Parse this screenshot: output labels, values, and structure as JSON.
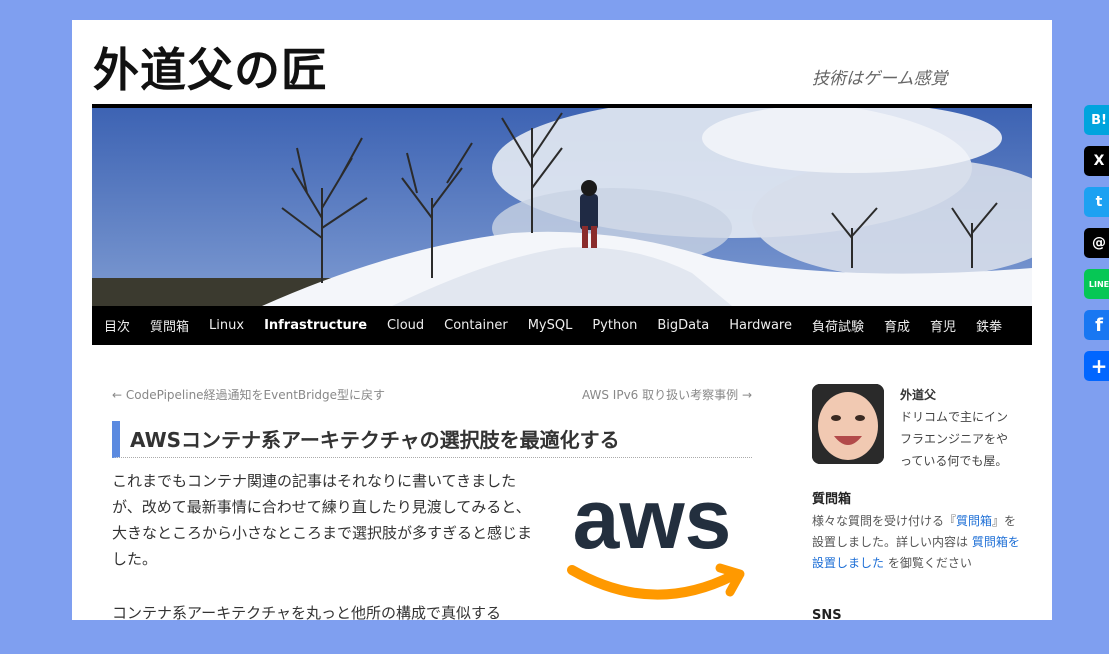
{
  "site": {
    "title": "外道父の匠",
    "description": "技術はゲーム感覚"
  },
  "nav": {
    "items": [
      "目次",
      "質問箱",
      "Linux",
      "Infrastructure",
      "Cloud",
      "Container",
      "MySQL",
      "Python",
      "BigData",
      "Hardware",
      "負荷試験",
      "育成",
      "育児",
      "鉄拳"
    ],
    "active": "Infrastructure"
  },
  "post": {
    "prev_link": "← CodePipeline経過通知をEventBridge型に戻す",
    "next_link": "AWS IPv6 取り扱い考察事例 →",
    "title": "AWSコンテナ系アーキテクチャの選択肢を最適化する",
    "para1": "これまでもコンテナ関連の記事はそれなりに書いてきましたが、改めて最新事情に合わせて練り直したり見渡してみると、大きなところから小さなところまで選択肢が多すぎると感じました。",
    "para2": "コンテナ系アーキテクチャを丸っと他所の構成で真似する",
    "logo_text": "aws"
  },
  "sidebar": {
    "profile_name": "外道父",
    "profile_text": "ドリコムで主にインフラエンジニアをやっている何でも屋。",
    "widget_title": "質問箱",
    "widget_text_1": "様々な質問を受け付ける『",
    "widget_link_1": "質問箱",
    "widget_text_2": "』を設置しました。詳しい内容は ",
    "widget_link_2": "質問箱を設置しました",
    "widget_text_3": " を御覧ください",
    "sns_title": "SNS"
  },
  "share": {
    "buttons": [
      {
        "name": "hatena",
        "label": "B!",
        "color": "#00a4de"
      },
      {
        "name": "x",
        "label": "X",
        "color": "#000000"
      },
      {
        "name": "twitter",
        "label": "t",
        "color": "#1da1f2"
      },
      {
        "name": "threads",
        "label": "@",
        "color": "#000000"
      },
      {
        "name": "line",
        "label": "LINE",
        "color": "#06c755"
      },
      {
        "name": "facebook",
        "label": "f",
        "color": "#1877f2"
      },
      {
        "name": "addtoany",
        "label": "+",
        "color": "#0166ff"
      }
    ]
  },
  "colors": {
    "background": "#7f9ff0",
    "accent": "#5b8ae0",
    "link": "#1e6fd6",
    "aws_orange": "#ff9900",
    "aws_navy": "#232f3e"
  }
}
